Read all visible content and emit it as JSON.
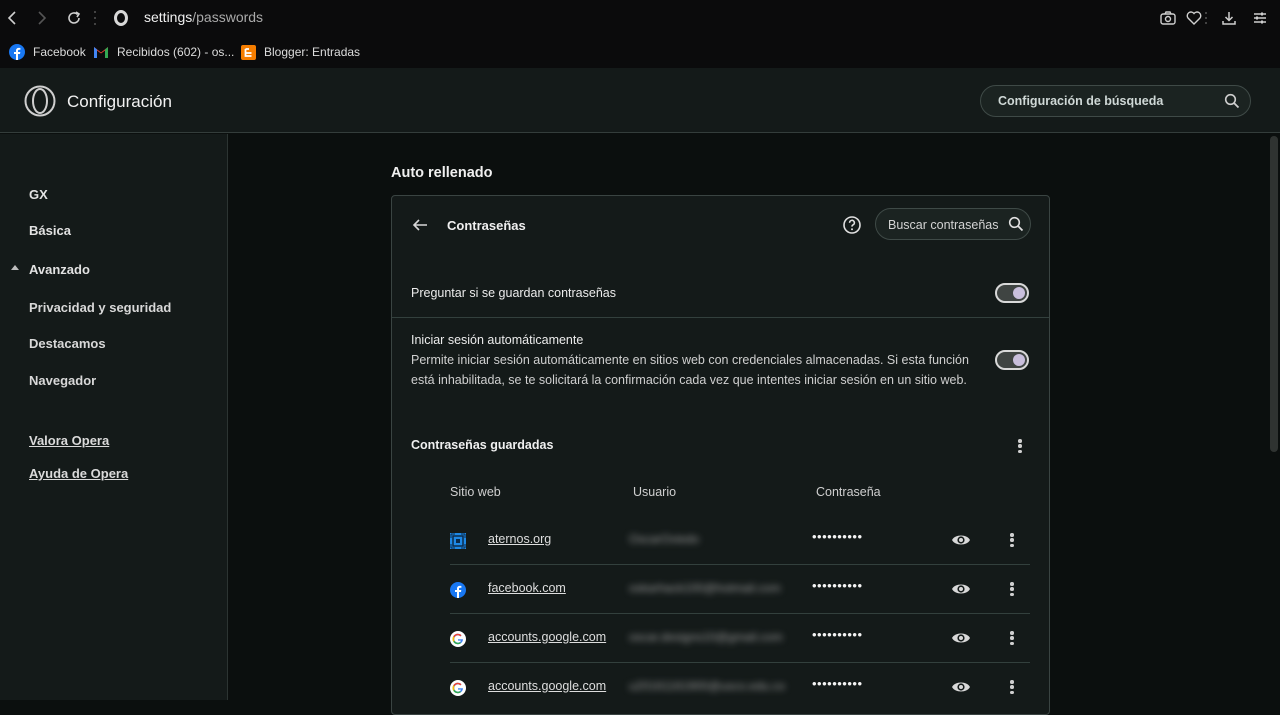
{
  "browser": {
    "url_host": "settings",
    "url_path": "/passwords",
    "bookmarks": [
      {
        "label": "Facebook",
        "icon": "facebook-icon"
      },
      {
        "label": "Recibidos (602) - os...",
        "icon": "gmail-icon"
      },
      {
        "label": "Blogger: Entradas",
        "icon": "blogger-icon"
      }
    ],
    "toolbar_icons": [
      "camera-icon",
      "heart-icon",
      "download-icon",
      "easy-setup-icon"
    ]
  },
  "header": {
    "title": "Configuración",
    "search_placeholder": "Configuración de búsqueda"
  },
  "sidebar": {
    "items": [
      {
        "label": "GX"
      },
      {
        "label": "Básica"
      },
      {
        "label": "Avanzado",
        "expanded": true
      },
      {
        "label": "Privacidad y seguridad"
      },
      {
        "label": "Destacamos"
      },
      {
        "label": "Navegador"
      }
    ],
    "links": [
      {
        "label": "Valora Opera"
      },
      {
        "label": "Ayuda de Opera"
      }
    ]
  },
  "main": {
    "section_title": "Auto rellenado",
    "panel": {
      "title": "Contraseñas",
      "search_placeholder": "Buscar contraseñas",
      "settings": [
        {
          "label": "Preguntar si se guardan contraseñas",
          "enabled": true
        },
        {
          "label": "Iniciar sesión automáticamente",
          "description": "Permite iniciar sesión automáticamente en sitios web con credenciales almacenadas. Si esta función está inhabilitada, se te solicitará la confirmación cada vez que intentes iniciar sesión en un sitio web.",
          "enabled": true
        }
      ],
      "saved": {
        "title": "Contraseñas guardadas",
        "columns": [
          "Sitio web",
          "Usuario",
          "Contraseña"
        ],
        "rows": [
          {
            "site": "aternos.org",
            "user": "OscarOviedo",
            "password": "••••••••••",
            "favicon": "aternos-icon"
          },
          {
            "site": "facebook.com",
            "user": "oskarhack100@hotmail.com",
            "password": "••••••••••",
            "favicon": "facebook-icon"
          },
          {
            "site": "accounts.google.com",
            "user": "oscar.designs10@gmail.com",
            "password": "••••••••••",
            "favicon": "google-icon"
          },
          {
            "site": "accounts.google.com",
            "user": "u20161161900@usco.edu.co",
            "password": "••••••••••",
            "favicon": "google-icon"
          }
        ]
      }
    }
  }
}
